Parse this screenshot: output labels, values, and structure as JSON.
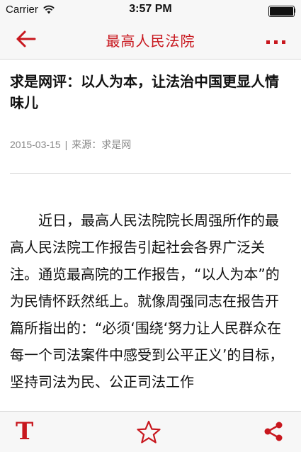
{
  "status_bar": {
    "carrier": "Carrier",
    "time": "3:57 PM"
  },
  "nav": {
    "title": "最高人民法院",
    "back_icon": "back-arrow-icon",
    "more_icon": "more-dots-icon"
  },
  "article": {
    "headline": "求是网评：以人为本，让法治中国更显人情味儿",
    "date": "2015-03-15",
    "separator": "|",
    "source": "来源：求是网",
    "body": "近日，最高人民法院院长周强所作的最高人民法院工作报告引起社会各界广泛关注。通览最高院的工作报告，“以人为本”的为民情怀跃然纸上。就像周强同志在报告开篇所指出的：“必须‘围绕‘努力让人民群众在每一个司法案件中感受到公平正义’的目标，坚持司法为民、公正司法工作"
  },
  "toolbar": {
    "font_button_label": "T",
    "favorite_icon": "star-icon",
    "share_icon": "share-icon"
  },
  "colors": {
    "accent": "#c8171e",
    "bar_background": "#f7f7f7",
    "meta_text": "#888888"
  }
}
